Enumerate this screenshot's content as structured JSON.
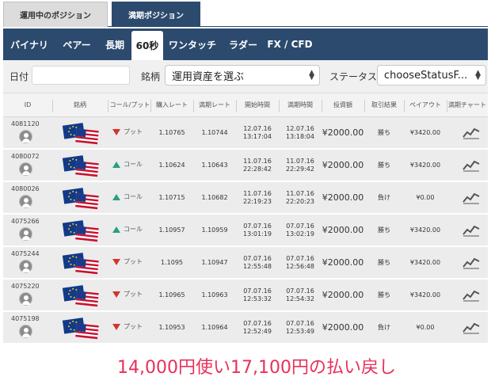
{
  "top_tabs": [
    "運用中のポジション",
    "満期ポジション"
  ],
  "nav": [
    "バイナリ",
    "ペアー",
    "長期",
    "60秒",
    "ワンタッチ",
    "ラダー",
    "FX / CFD"
  ],
  "filters": {
    "date_label": "日付",
    "date_value": "",
    "asset_label": "銘柄",
    "asset_select": "運用資産を選ぶ",
    "status_label": "ステータス",
    "status_select": "chooseStatusF..."
  },
  "columns": [
    "ID",
    "銘柄",
    "コール/プット",
    "購入レート",
    "満期レート",
    "開始時間",
    "満期時間",
    "投資額",
    "取引結果",
    "ペイアウト",
    "満期チャート"
  ],
  "rows": [
    {
      "id": "4081120",
      "dir": "up_down",
      "direction": "プット",
      "buy": "1.10765",
      "expiry": "1.10744",
      "start_date": "12.07.16",
      "start_time": "13:17:04",
      "end_date": "12.07.16",
      "end_time": "13:18:04",
      "amount": "¥2000.00",
      "result": "勝ち",
      "payout": "¥3420.00"
    },
    {
      "id": "4080072",
      "direction": "コール",
      "buy": "1.10624",
      "expiry": "1.10643",
      "start_date": "11.07.16",
      "start_time": "22:28:42",
      "end_date": "11.07.16",
      "end_time": "22:29:42",
      "amount": "¥2000.00",
      "result": "勝ち",
      "payout": "¥3420.00"
    },
    {
      "id": "4080026",
      "direction": "コール",
      "buy": "1.10715",
      "expiry": "1.10682",
      "start_date": "11.07.16",
      "start_time": "22:19:23",
      "end_date": "11.07.16",
      "end_time": "22:20:23",
      "amount": "¥2000.00",
      "result": "負け",
      "payout": "¥0.00"
    },
    {
      "id": "4075266",
      "direction": "コール",
      "buy": "1.10957",
      "expiry": "1.10959",
      "start_date": "07.07.16",
      "start_time": "13:01:19",
      "end_date": "07.07.16",
      "end_time": "13:02:19",
      "amount": "¥2000.00",
      "result": "勝ち",
      "payout": "¥3420.00"
    },
    {
      "id": "4075244",
      "direction": "プット",
      "buy": "1.1095",
      "expiry": "1.10947",
      "start_date": "07.07.16",
      "start_time": "12:55:48",
      "end_date": "07.07.16",
      "end_time": "12:56:48",
      "amount": "¥2000.00",
      "result": "勝ち",
      "payout": "¥3420.00"
    },
    {
      "id": "4075220",
      "direction": "プット",
      "buy": "1.10965",
      "expiry": "1.10963",
      "start_date": "07.07.16",
      "start_time": "12:53:32",
      "end_date": "07.07.16",
      "end_time": "12:54:32",
      "amount": "¥2000.00",
      "result": "勝ち",
      "payout": "¥3420.00"
    },
    {
      "id": "4075198",
      "direction": "プット",
      "buy": "1.10953",
      "expiry": "1.10964",
      "start_date": "07.07.16",
      "start_time": "12:52:49",
      "end_date": "07.07.16",
      "end_time": "12:53:49",
      "amount": "¥2000.00",
      "result": "負け",
      "payout": "¥0.00"
    }
  ],
  "footer_text": "14,000円使い17,100円の払い戻し",
  "colors": {
    "nav": "#2c4a6e",
    "put": "#d2362b",
    "call": "#26a083",
    "footer": "#e8305a"
  },
  "icons": {
    "row_avatar": "user-icon",
    "pair": "eur-usd-flags-icon",
    "chart": "line-chart-icon",
    "select": "chevron-updown-icon"
  }
}
